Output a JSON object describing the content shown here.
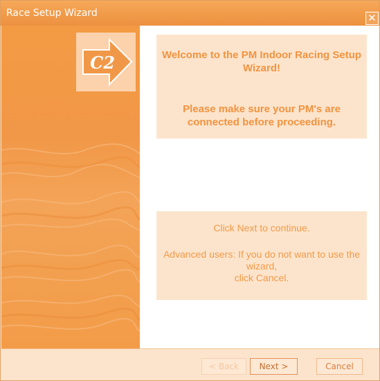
{
  "window": {
    "title": "Race Setup Wizard",
    "close_glyph": "✕"
  },
  "logo": {
    "text": "C2",
    "icon": "c2-arrow-logo"
  },
  "welcome": {
    "line1": "Welcome to the PM Indoor Racing Setup Wizard!",
    "line2": "Please make sure your PM's are connected before proceeding."
  },
  "info": {
    "line1": "Click Next to continue.",
    "line2a": "Advanced users: If you do not want to use the wizard,",
    "line2b": "click Cancel."
  },
  "buttons": {
    "back": "< Back",
    "next": "Next >",
    "cancel": "Cancel"
  },
  "colors": {
    "accent": "#f29340",
    "panel": "#fce4cc",
    "titlebar": "#f09a48"
  }
}
